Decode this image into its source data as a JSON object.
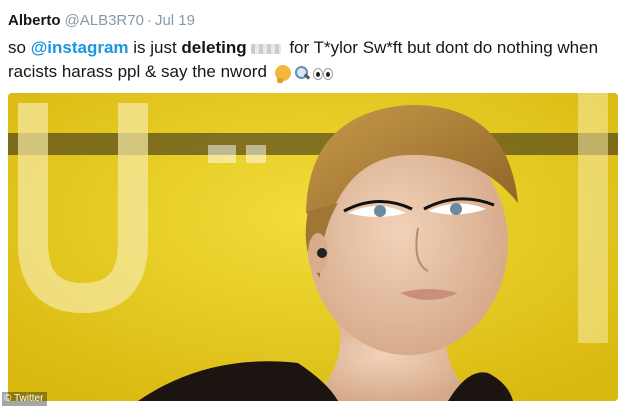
{
  "tweet": {
    "author": "Alberto",
    "handle": "@ALB3R70",
    "separator": "·",
    "date": "Jul 19",
    "text": {
      "part1": "so ",
      "mention": "@instagram",
      "part2": " is just ",
      "bold": "deleting",
      "part3": " for T*ylor Sw*ft but dont do nothing when racists harass ppl & say the nword"
    },
    "emojis": [
      "thinking-face",
      "magnifying-glass",
      "eyes"
    ]
  },
  "media": {
    "description_icon": "photo",
    "background_color": "#e8cf1f"
  },
  "watermark": "© Twitter"
}
